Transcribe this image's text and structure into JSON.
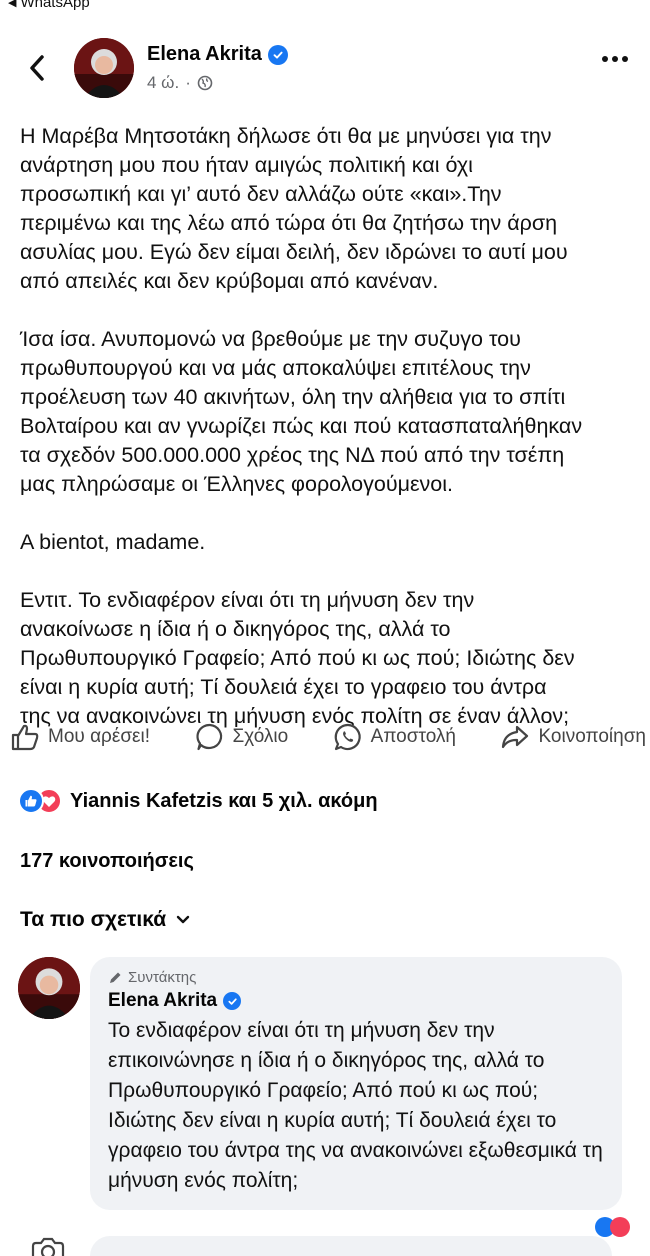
{
  "status": {
    "back_label": "WhatsApp"
  },
  "post": {
    "author": "Elena Akrita",
    "time": "4 ώ.",
    "paragraphs": [
      "Η Μαρέβα Μητσοτάκη δήλωσε ότι θα με μηνύσει για την\nανάρτηση μου που ήταν αμιγώς πολιτική και όχι\nπροσωπική και γι’ αυτό δεν αλλάζω ούτε «και».Την\nπεριμένω και της λέω από τώρα ότι θα ζητήσω την άρση\nασυλίας μου. Εγώ δεν είμαι δειλή, δεν ιδρώνει το αυτί μου\nαπό απειλές και δεν κρύβομαι από κανέναν.",
      "Ίσα ίσα. Ανυπομονώ να βρεθούμε με την συζυγο του\nπρωθυπουργού και να μάς αποκαλύψει επιτέλους την\nπροέλευση των 40 ακινήτων, όλη την αλήθεια για το σπίτι\nΒολταίρου και αν γνωρίζει πώς και πού κατασπαταλήθηκαν\nτα σχεδόν 500.000.000 χρέος της ΝΔ πού από την τσέπη\nμας πληρώσαμε οι Έλληνες φορολογούμενοι.",
      "A bientot, madame.",
      "Εντιτ. Το ενδιαφέρον είναι ότι τη μήνυση δεν την\nανακοίνωσε η ίδια ή ο δικηγόρος της, αλλά το\nΠρωθυπουργικό Γραφείο; Από πού κι ως πού; Ιδιώτης δεν\nείναι η κυρία αυτή; Τί δουλειά έχει το γραφειο του άντρα\nτης να ανακοινώνει τη μήνυση ενός πολίτη σε έναν άλλον;"
    ]
  },
  "actions": {
    "like": "Μου αρέσει!",
    "comment": "Σχόλιο",
    "send": "Αποστολή",
    "share": "Κοινοποίηση"
  },
  "reactions_summary": "Yiannis Kafetzis και 5 χιλ. ακόμη",
  "shares_count": "177 κοινοποιήσεις",
  "sort_label": "Τα πιο σχετικά",
  "comment": {
    "role": "Συντάκτης",
    "author": "Elena Akrita",
    "text": "Το ενδιαφέρον είναι ότι τη μήνυση δεν την επικοινώνησε η ίδια ή ο δικηγόρος της, αλλά το Πρωθυπουργικό Γραφείο; Από πού κι ως πού; Ιδιώτης δεν είναι η κυρία αυτή; Τί δουλειά έχει το γραφειο του άντρα της να ανακοινώνει εξωθεσμικά τη μήνυση ενός πολίτη;"
  },
  "colors": {
    "accent": "#1877f2",
    "love": "#f33e58",
    "bubble": "#f0f2f5"
  }
}
